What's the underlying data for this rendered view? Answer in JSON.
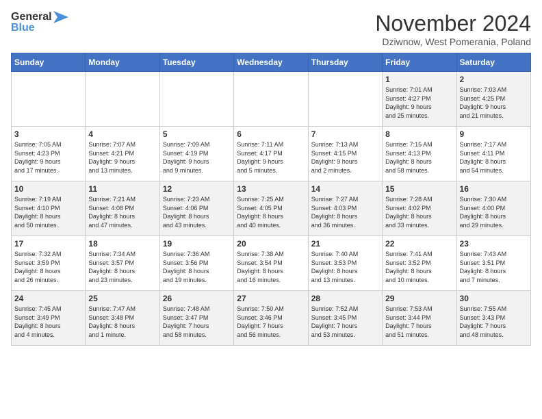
{
  "logo": {
    "line1": "General",
    "line2": "Blue"
  },
  "title": "November 2024",
  "subtitle": "Dziwnow, West Pomerania, Poland",
  "days_of_week": [
    "Sunday",
    "Monday",
    "Tuesday",
    "Wednesday",
    "Thursday",
    "Friday",
    "Saturday"
  ],
  "weeks": [
    [
      {
        "num": "",
        "info": ""
      },
      {
        "num": "",
        "info": ""
      },
      {
        "num": "",
        "info": ""
      },
      {
        "num": "",
        "info": ""
      },
      {
        "num": "",
        "info": ""
      },
      {
        "num": "1",
        "info": "Sunrise: 7:01 AM\nSunset: 4:27 PM\nDaylight: 9 hours\nand 25 minutes."
      },
      {
        "num": "2",
        "info": "Sunrise: 7:03 AM\nSunset: 4:25 PM\nDaylight: 9 hours\nand 21 minutes."
      }
    ],
    [
      {
        "num": "3",
        "info": "Sunrise: 7:05 AM\nSunset: 4:23 PM\nDaylight: 9 hours\nand 17 minutes."
      },
      {
        "num": "4",
        "info": "Sunrise: 7:07 AM\nSunset: 4:21 PM\nDaylight: 9 hours\nand 13 minutes."
      },
      {
        "num": "5",
        "info": "Sunrise: 7:09 AM\nSunset: 4:19 PM\nDaylight: 9 hours\nand 9 minutes."
      },
      {
        "num": "6",
        "info": "Sunrise: 7:11 AM\nSunset: 4:17 PM\nDaylight: 9 hours\nand 5 minutes."
      },
      {
        "num": "7",
        "info": "Sunrise: 7:13 AM\nSunset: 4:15 PM\nDaylight: 9 hours\nand 2 minutes."
      },
      {
        "num": "8",
        "info": "Sunrise: 7:15 AM\nSunset: 4:13 PM\nDaylight: 8 hours\nand 58 minutes."
      },
      {
        "num": "9",
        "info": "Sunrise: 7:17 AM\nSunset: 4:11 PM\nDaylight: 8 hours\nand 54 minutes."
      }
    ],
    [
      {
        "num": "10",
        "info": "Sunrise: 7:19 AM\nSunset: 4:10 PM\nDaylight: 8 hours\nand 50 minutes."
      },
      {
        "num": "11",
        "info": "Sunrise: 7:21 AM\nSunset: 4:08 PM\nDaylight: 8 hours\nand 47 minutes."
      },
      {
        "num": "12",
        "info": "Sunrise: 7:23 AM\nSunset: 4:06 PM\nDaylight: 8 hours\nand 43 minutes."
      },
      {
        "num": "13",
        "info": "Sunrise: 7:25 AM\nSunset: 4:05 PM\nDaylight: 8 hours\nand 40 minutes."
      },
      {
        "num": "14",
        "info": "Sunrise: 7:27 AM\nSunset: 4:03 PM\nDaylight: 8 hours\nand 36 minutes."
      },
      {
        "num": "15",
        "info": "Sunrise: 7:28 AM\nSunset: 4:02 PM\nDaylight: 8 hours\nand 33 minutes."
      },
      {
        "num": "16",
        "info": "Sunrise: 7:30 AM\nSunset: 4:00 PM\nDaylight: 8 hours\nand 29 minutes."
      }
    ],
    [
      {
        "num": "17",
        "info": "Sunrise: 7:32 AM\nSunset: 3:59 PM\nDaylight: 8 hours\nand 26 minutes."
      },
      {
        "num": "18",
        "info": "Sunrise: 7:34 AM\nSunset: 3:57 PM\nDaylight: 8 hours\nand 23 minutes."
      },
      {
        "num": "19",
        "info": "Sunrise: 7:36 AM\nSunset: 3:56 PM\nDaylight: 8 hours\nand 19 minutes."
      },
      {
        "num": "20",
        "info": "Sunrise: 7:38 AM\nSunset: 3:54 PM\nDaylight: 8 hours\nand 16 minutes."
      },
      {
        "num": "21",
        "info": "Sunrise: 7:40 AM\nSunset: 3:53 PM\nDaylight: 8 hours\nand 13 minutes."
      },
      {
        "num": "22",
        "info": "Sunrise: 7:41 AM\nSunset: 3:52 PM\nDaylight: 8 hours\nand 10 minutes."
      },
      {
        "num": "23",
        "info": "Sunrise: 7:43 AM\nSunset: 3:51 PM\nDaylight: 8 hours\nand 7 minutes."
      }
    ],
    [
      {
        "num": "24",
        "info": "Sunrise: 7:45 AM\nSunset: 3:49 PM\nDaylight: 8 hours\nand 4 minutes."
      },
      {
        "num": "25",
        "info": "Sunrise: 7:47 AM\nSunset: 3:48 PM\nDaylight: 8 hours\nand 1 minute."
      },
      {
        "num": "26",
        "info": "Sunrise: 7:48 AM\nSunset: 3:47 PM\nDaylight: 7 hours\nand 58 minutes."
      },
      {
        "num": "27",
        "info": "Sunrise: 7:50 AM\nSunset: 3:46 PM\nDaylight: 7 hours\nand 56 minutes."
      },
      {
        "num": "28",
        "info": "Sunrise: 7:52 AM\nSunset: 3:45 PM\nDaylight: 7 hours\nand 53 minutes."
      },
      {
        "num": "29",
        "info": "Sunrise: 7:53 AM\nSunset: 3:44 PM\nDaylight: 7 hours\nand 51 minutes."
      },
      {
        "num": "30",
        "info": "Sunrise: 7:55 AM\nSunset: 3:43 PM\nDaylight: 7 hours\nand 48 minutes."
      }
    ]
  ]
}
